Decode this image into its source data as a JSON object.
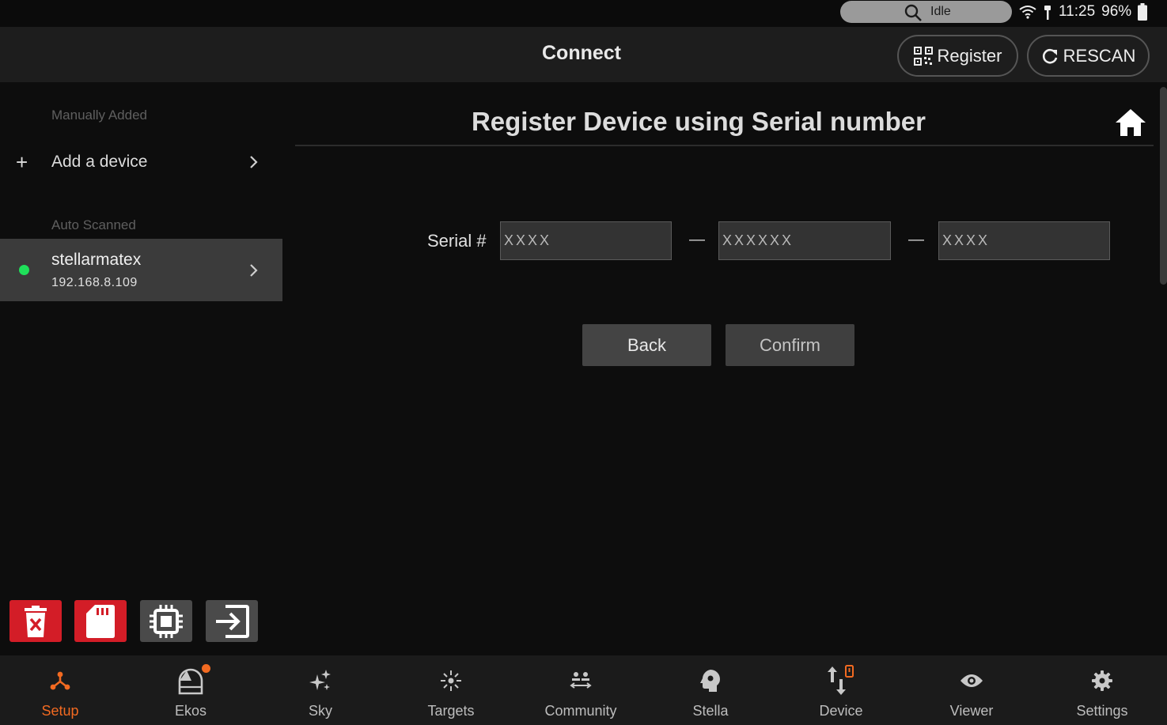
{
  "status_bar": {
    "search_status": "Idle",
    "time": "11:25",
    "battery": "96%"
  },
  "header": {
    "title": "Connect",
    "register_label": "Register",
    "rescan_label": "RESCAN"
  },
  "sidebar": {
    "manual_section": "Manually Added",
    "add_device_label": "Add a device",
    "auto_section": "Auto Scanned",
    "device": {
      "name": "stellarmatex",
      "ip": "192.168.8.109",
      "status_color": "#1fe05a"
    }
  },
  "main": {
    "title": "Register Device using Serial number",
    "serial_label": "Serial #",
    "serial_parts": [
      {
        "placeholder": "XXXX",
        "value": ""
      },
      {
        "placeholder": "XXXXXX",
        "value": ""
      },
      {
        "placeholder": "XXXX",
        "value": ""
      }
    ],
    "separator": "—",
    "back_label": "Back",
    "confirm_label": "Confirm"
  },
  "tool_buttons": [
    {
      "icon": "sd-delete-icon",
      "color": "#d31d27"
    },
    {
      "icon": "sd-card-icon",
      "color": "#d31d27"
    },
    {
      "icon": "chip-icon",
      "color": "#4a4a4a"
    },
    {
      "icon": "exit-icon",
      "color": "#4a4a4a"
    }
  ],
  "nav": [
    {
      "label": "Setup",
      "icon": "setup-icon",
      "active": true
    },
    {
      "label": "Ekos",
      "icon": "observatory-icon"
    },
    {
      "label": "Sky",
      "icon": "sparkle-icon"
    },
    {
      "label": "Targets",
      "icon": "target-icon"
    },
    {
      "label": "Community",
      "icon": "community-icon"
    },
    {
      "label": "Stella",
      "icon": "stella-icon"
    },
    {
      "label": "Device",
      "icon": "device-transfer-icon"
    },
    {
      "label": "Viewer",
      "icon": "eye-icon"
    },
    {
      "label": "Settings",
      "icon": "gear-icon"
    }
  ],
  "colors": {
    "accent": "#f26a21",
    "danger": "#d31d27",
    "online": "#1fe05a"
  }
}
